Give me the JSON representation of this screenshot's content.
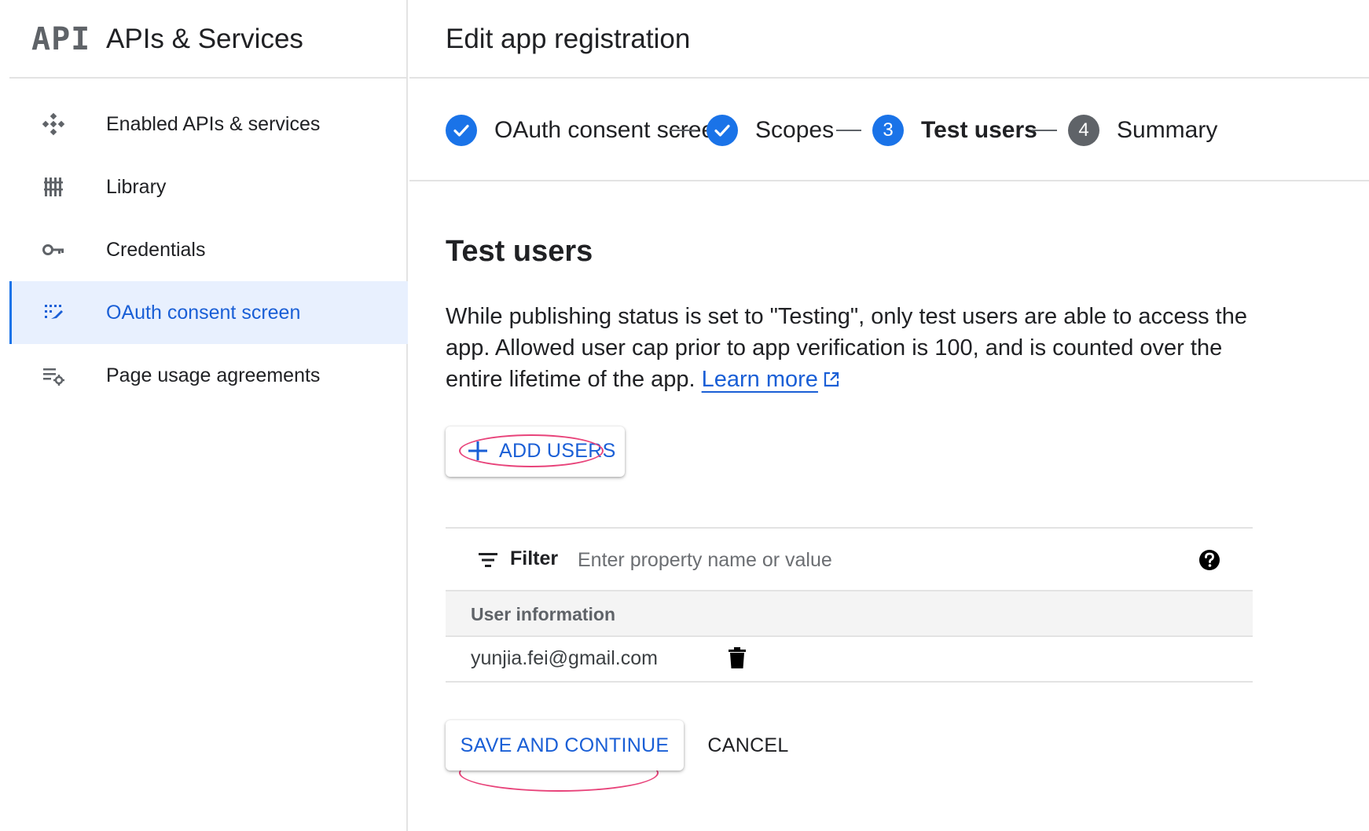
{
  "sidebar": {
    "logo_text": "API",
    "product_title": "APIs & Services",
    "items": [
      {
        "label": "Enabled APIs & services",
        "icon": "diamond-grid-icon"
      },
      {
        "label": "Library",
        "icon": "library-icon"
      },
      {
        "label": "Credentials",
        "icon": "key-icon"
      },
      {
        "label": "OAuth consent screen",
        "icon": "consent-icon",
        "active": true
      },
      {
        "label": "Page usage agreements",
        "icon": "settings-list-icon"
      }
    ]
  },
  "header": {
    "title": "Edit app registration"
  },
  "stepper": {
    "steps": [
      {
        "number": "",
        "label": "OAuth consent screen",
        "state": "done"
      },
      {
        "number": "",
        "label": "Scopes",
        "state": "done"
      },
      {
        "number": "3",
        "label": "Test users",
        "state": "current"
      },
      {
        "number": "4",
        "label": "Summary",
        "state": "todo"
      }
    ]
  },
  "section": {
    "title": "Test users",
    "description": "While publishing status is set to \"Testing\", only test users are able to access the app. Allowed user cap prior to app verification is 100, and is counted over the entire lifetime of the app.",
    "learn_more": "Learn more"
  },
  "add_users_label": "ADD USERS",
  "filter": {
    "label": "Filter",
    "placeholder": "Enter property name or value"
  },
  "table": {
    "column_header": "User information",
    "rows": [
      {
        "email": "yunjia.fei@gmail.com"
      }
    ]
  },
  "actions": {
    "save_label": "SAVE AND CONTINUE",
    "cancel_label": "CANCEL"
  },
  "colors": {
    "accent": "#1a73e8",
    "link": "#1a5fd6",
    "active_bg": "#e8f0fe",
    "annotation": "#e8437a"
  }
}
